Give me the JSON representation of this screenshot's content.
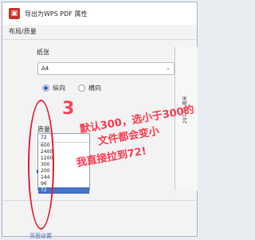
{
  "window": {
    "title": "导出为WPS PDF 属性",
    "tab": "布局/质量",
    "paper_label": "纸张",
    "paper_value": "A4",
    "orientation": {
      "portrait_label": "纵向",
      "landscape_label": "横向"
    },
    "quality_label": "质量",
    "quality_current": "72",
    "quality_options": [
      "600",
      "2400",
      "1200",
      "300",
      "200",
      "144",
      "96",
      "72"
    ],
    "preview_dimension": "297.00 毫米",
    "footer_link": "页面设置"
  },
  "annotation": {
    "step": "3",
    "line1": "默认300，选小于300的",
    "line2": "文件都会变小",
    "line3": "我直接拉到72!"
  },
  "colors": {
    "accent": "#1f5fc8",
    "selection": "#4472c4",
    "annotation": "#ff3b4f",
    "pdf_icon": "#c83427"
  }
}
